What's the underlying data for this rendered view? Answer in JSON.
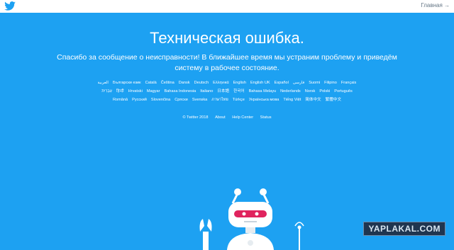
{
  "header": {
    "logo_icon": "twitter-bird-icon",
    "home_link": "Главная →"
  },
  "main": {
    "title": "Техническая ошибка.",
    "subtitle": "Спасибо за сообщение о неисправности! В ближайшее время мы устраним проблему и приведём систему в рабочее состояние."
  },
  "languages": [
    "العربية",
    "Български език",
    "Català",
    "Čeština",
    "Dansk",
    "Deutsch",
    "Ελληνικά",
    "English",
    "English UK",
    "Español",
    "فارسی",
    "Suomi",
    "Filipino",
    "Français",
    "עִבְרִית",
    "हिन्दी",
    "Hrvatski",
    "Magyar",
    "Bahasa Indonesia",
    "Italiano",
    "日本語",
    "한국어",
    "Bahasa Melayu",
    "Nederlands",
    "Norsk",
    "Polski",
    "Português",
    "Română",
    "Русский",
    "Slovenčina",
    "Српски",
    "Svenska",
    "ภาษาไทย",
    "Türkçe",
    "Українська мова",
    "Tiếng Việt",
    "简体中文",
    "繁體中文"
  ],
  "footer": {
    "copyright": "© Twitter 2018",
    "about": "About",
    "help": "Help Center",
    "status": "Status"
  },
  "watermark": "YAPLAKAL.COM",
  "colors": {
    "background": "#1da1f2",
    "topbar": "#ffffff",
    "text": "#ffffff"
  }
}
